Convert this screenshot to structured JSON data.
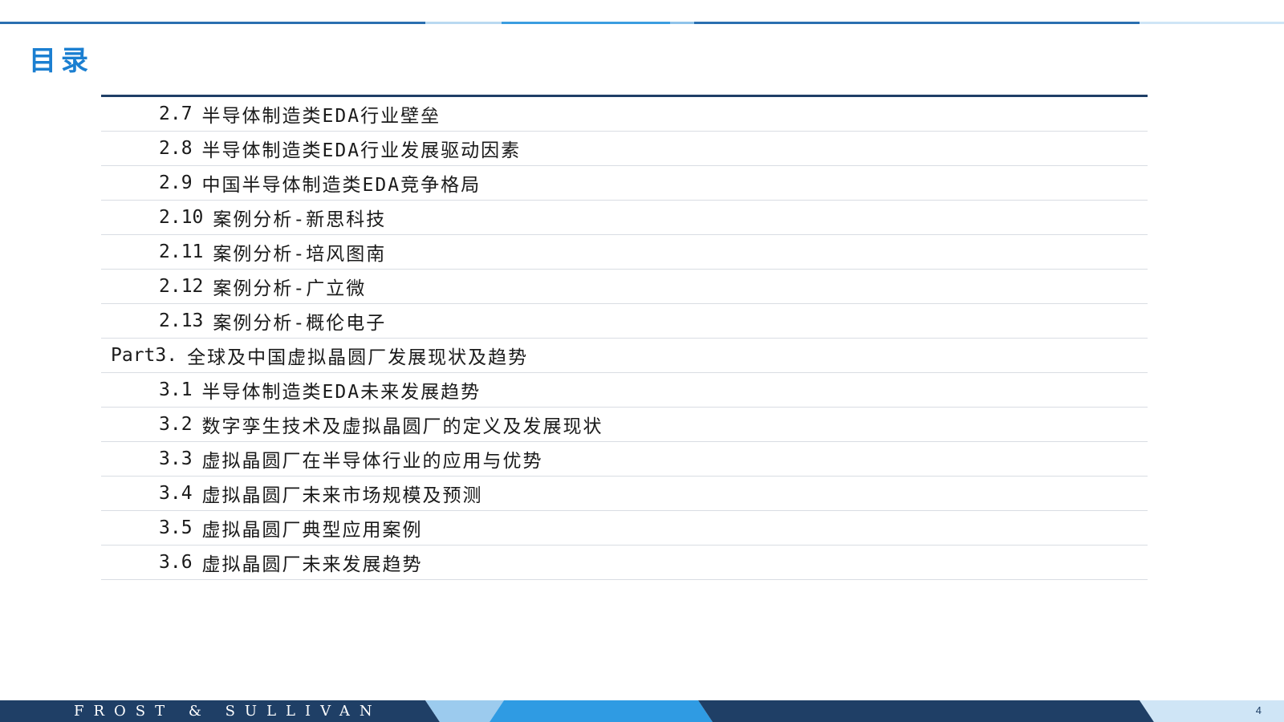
{
  "title": "目录",
  "colors": {
    "accent": "#1b7fd1",
    "navy": "#1f3f66",
    "light_blue": "#8fc3ea",
    "rule": "#d9dde3"
  },
  "toc": [
    {
      "num": "2.7",
      "text": "半导体制造类EDA行业壁垒",
      "level": "sub"
    },
    {
      "num": "2.8",
      "text": "半导体制造类EDA行业发展驱动因素",
      "level": "sub"
    },
    {
      "num": "2.9",
      "text": "中国半导体制造类EDA竞争格局",
      "level": "sub"
    },
    {
      "num": "2.10",
      "text": "案例分析-新思科技",
      "level": "sub"
    },
    {
      "num": "2.11",
      "text": "案例分析-培风图南",
      "level": "sub"
    },
    {
      "num": "2.12",
      "text": "案例分析-广立微",
      "level": "sub"
    },
    {
      "num": "2.13",
      "text": "案例分析-概伦电子",
      "level": "sub"
    },
    {
      "num": "Part3.",
      "text": "全球及中国虚拟晶圆厂发展现状及趋势",
      "level": "part"
    },
    {
      "num": "3.1",
      "text": "半导体制造类EDA未来发展趋势",
      "level": "sub"
    },
    {
      "num": "3.2",
      "text": "数字孪生技术及虚拟晶圆厂的定义及发展现状",
      "level": "sub"
    },
    {
      "num": "3.3",
      "text": "虚拟晶圆厂在半导体行业的应用与优势",
      "level": "sub"
    },
    {
      "num": "3.4",
      "text": "虚拟晶圆厂未来市场规模及预测",
      "level": "sub"
    },
    {
      "num": "3.5",
      "text": "虚拟晶圆厂典型应用案例",
      "level": "sub"
    },
    {
      "num": "3.6",
      "text": "虚拟晶圆厂未来发展趋势",
      "level": "sub"
    }
  ],
  "footer": {
    "brand": "FROST & SULLIVAN",
    "page_number": "4"
  }
}
